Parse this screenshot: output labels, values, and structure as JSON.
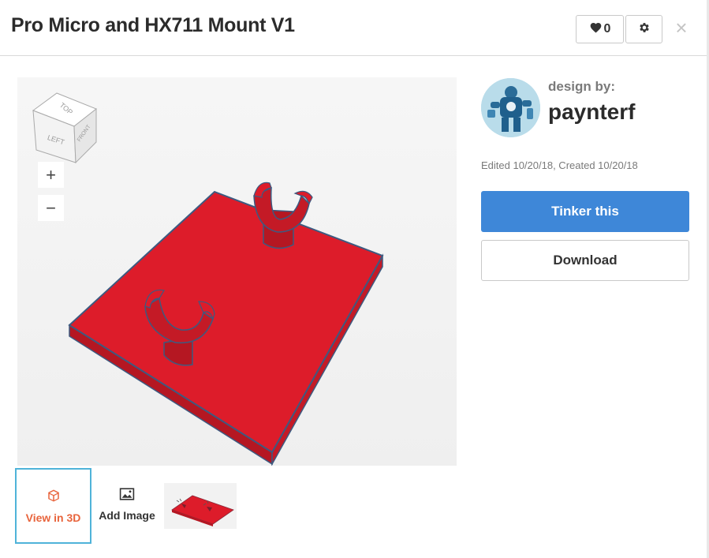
{
  "header": {
    "title": "Pro Micro and HX711 Mount V1",
    "like_count": "0"
  },
  "viewer": {
    "view_cube": {
      "top": "TOP",
      "left": "LEFT",
      "front": "FRONT"
    },
    "zoom_in": "+",
    "zoom_out": "−",
    "model_color": "#dd1c2a",
    "outline_color": "#3d5a80"
  },
  "thumbnails": {
    "view_3d_label": "View in 3D",
    "add_image_label": "Add Image"
  },
  "author": {
    "design_by_label": "design by:",
    "name": "paynterf",
    "dates": "Edited 10/20/18, Created 10/20/18"
  },
  "actions": {
    "tinker_label": "Tinker this",
    "download_label": "Download"
  },
  "colors": {
    "accent": "#3e87d8",
    "active_thumb_border": "#4fb3d9",
    "view3d_text": "#e8643c"
  },
  "icons": {
    "like": "heart-icon",
    "settings": "gear-icon",
    "close": "close-icon",
    "view3d": "cube-icon",
    "add_image": "image-icon"
  }
}
